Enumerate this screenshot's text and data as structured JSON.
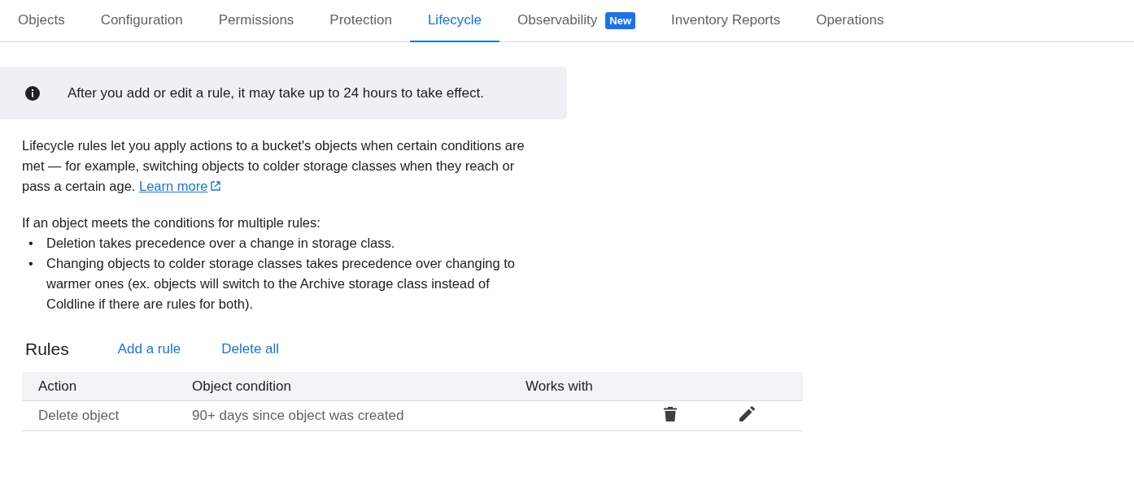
{
  "tabs": [
    {
      "label": "Objects",
      "selected": false
    },
    {
      "label": "Configuration",
      "selected": false
    },
    {
      "label": "Permissions",
      "selected": false
    },
    {
      "label": "Protection",
      "selected": false
    },
    {
      "label": "Lifecycle",
      "selected": true
    },
    {
      "label": "Observability",
      "selected": false,
      "badge": "New"
    },
    {
      "label": "Inventory Reports",
      "selected": false
    },
    {
      "label": "Operations",
      "selected": false
    }
  ],
  "banner": {
    "text": "After you add or edit a rule, it may take up to 24 hours to take effect."
  },
  "intro": {
    "text": "Lifecycle rules let you apply actions to a bucket's objects when certain conditions are met — for example, switching objects to colder storage classes when they reach or pass a certain age.",
    "link": "Learn more"
  },
  "precedence": {
    "heading": "If an object meets the conditions for multiple rules:",
    "bullets": [
      {
        "marker": "•",
        "text": "Deletion takes precedence over a change in storage class."
      },
      {
        "marker": "•",
        "text": "Changing objects to colder storage classes takes precedence over changing to warmer ones (ex. objects will switch to the Archive storage class instead of Coldline if there are rules for both)."
      }
    ]
  },
  "rules": {
    "title": "Rules",
    "actions": [
      "Add a rule",
      "Delete all"
    ],
    "table": {
      "columns": [
        "Action",
        "Object condition",
        "Works with"
      ],
      "rows": [
        {
          "action": "Delete object",
          "condition": "90+ days since object was created"
        }
      ]
    }
  }
}
